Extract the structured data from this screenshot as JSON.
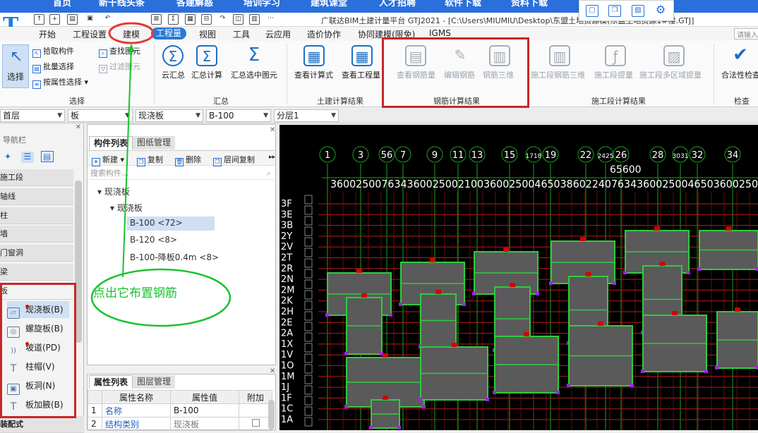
{
  "web_nav": [
    "首页",
    "新干线头条",
    "各建解惑",
    "培训学习",
    "建筑课堂",
    "人才招聘",
    "软件下载",
    "资料下载"
  ],
  "window_title": "广联达BIM土建计量平台 GTJ2021 - [C:\\Users\\MIUMIU\\Desktop\\东盟土地资源模(东盟土地资源1#楼.GTJ]",
  "logo": "T",
  "menu": [
    "开始",
    "工程设置",
    "建模",
    "工程量",
    "视图",
    "工具",
    "云应用",
    "造价协作",
    "协同建模(限免)",
    "IGMS"
  ],
  "search_placeholder": "请输入",
  "ribbon": {
    "select": {
      "label": "选择",
      "items": [
        "拾取构件",
        "批量选择",
        "按属性选择",
        "查找图元",
        "过滤图元"
      ],
      "group": "选择"
    },
    "summary": {
      "items": [
        "云汇总",
        "汇总计算",
        "汇总选中图元"
      ],
      "group": "汇总"
    },
    "civil": {
      "items": [
        "查看计算式",
        "查看工程量"
      ],
      "group": "土建计算结果"
    },
    "rebar": {
      "items": [
        "查看钢筋量",
        "编辑钢筋",
        "钢筋三维"
      ],
      "group": "钢筋计算结果"
    },
    "construction": {
      "items": [
        "施工段钢筋三维",
        "施工段提量",
        "施工段多区域提量"
      ],
      "group": "施工段计算结果"
    },
    "check": {
      "items": [
        "合法性检查"
      ],
      "group": "检查"
    }
  },
  "combos": {
    "floor": "首层",
    "category": "板",
    "type": "现浇板",
    "name": "B-100",
    "layer": "分层1"
  },
  "nav": {
    "title": "导航栏",
    "categories": [
      "施工段",
      "轴线",
      "柱",
      "墙",
      "门窗洞",
      "梁",
      "板"
    ],
    "slab_items": [
      "现浇板(B)",
      "螺旋板(B)",
      "坡道(PD)",
      "柱帽(V)",
      "板洞(N)",
      "板加腋(B)"
    ],
    "bottom": "装配式"
  },
  "component_list": {
    "tabs": [
      "构件列表",
      "图纸管理"
    ],
    "toolbar": [
      "新建",
      "复制",
      "删除",
      "层间复制"
    ],
    "search_placeholder": "搜索构件...",
    "tree": {
      "root": "现浇板",
      "child": "现浇板",
      "items": [
        "B-100 <72>",
        "B-120 <8>",
        "B-100-降板0.4m <8>"
      ]
    }
  },
  "property_panel": {
    "tabs": [
      "属性列表",
      "图层管理"
    ],
    "headers": [
      "属性名称",
      "属性值",
      "附加"
    ],
    "rows": [
      {
        "no": "1",
        "name": "名称",
        "value": "B-100"
      },
      {
        "no": "2",
        "name": "结构类别",
        "value": "现浇板"
      }
    ]
  },
  "canvas": {
    "axis_numbers": [
      "1",
      "3",
      "56",
      "7",
      "9",
      "11",
      "13",
      "15",
      "1718",
      "19",
      "22",
      "2425",
      "26",
      "28",
      "3031",
      "32",
      "34"
    ],
    "top_dimension": "65600",
    "segment_dims": "3600250076343600250021003600250046503860224076343600250046503600250",
    "row_labels": [
      "3F",
      "3E",
      "3B",
      "2Y",
      "2V",
      "2T",
      "2R",
      "2N",
      "2M",
      "2K",
      "2H",
      "2E",
      "2A",
      "1X",
      "1V",
      "1O",
      "1M",
      "1J",
      "1F",
      "1C",
      "1A"
    ]
  },
  "annotation": {
    "callout": "点出它布置钢筋",
    "color": "#19c22c",
    "box_color": "#c62828"
  }
}
